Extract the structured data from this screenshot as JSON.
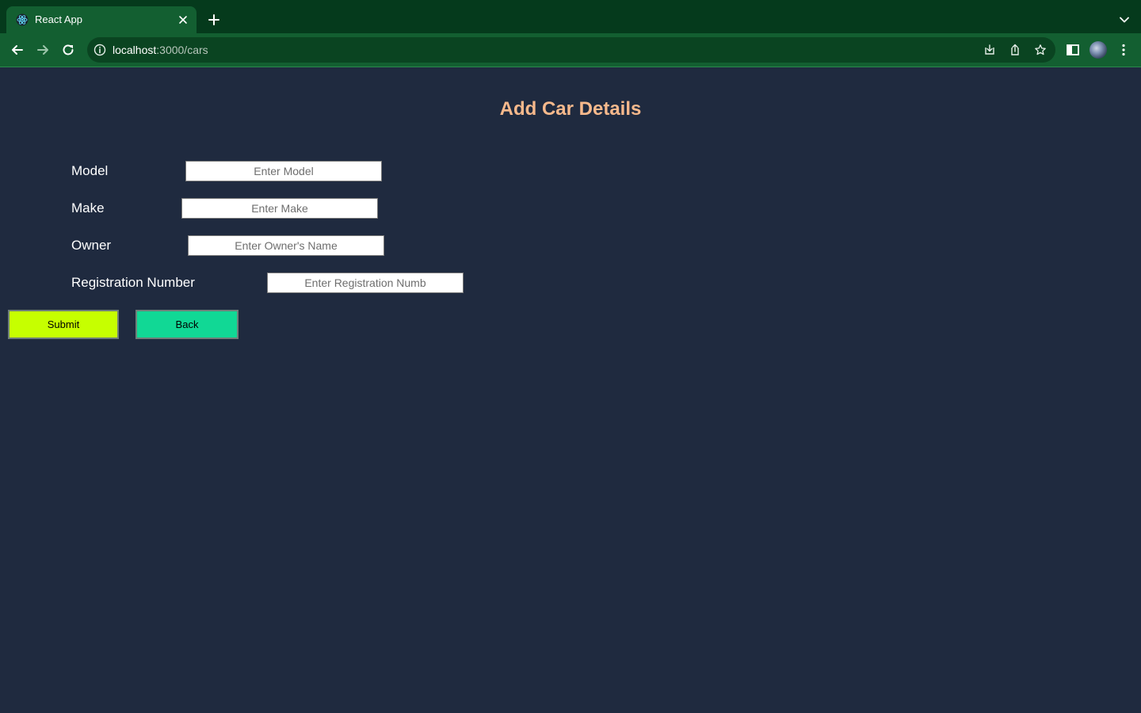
{
  "browser": {
    "tab_title": "React App",
    "url_host": "localhost",
    "url_rest": ":3000/cars",
    "icons": {
      "favicon": "react-logo-icon",
      "close": "close-icon",
      "new_tab": "plus-icon",
      "tab_list": "chevron-down-icon",
      "back": "arrow-left-icon",
      "forward": "arrow-right-icon",
      "reload": "reload-icon",
      "site_info": "info-icon",
      "install": "install-icon",
      "share": "share-icon",
      "bookmark": "star-icon",
      "side_panel": "side-panel-icon",
      "profile": "avatar",
      "menu": "kebab-menu-icon"
    },
    "colors": {
      "tabbar": "#053a1c",
      "toolbar": "#135f31"
    }
  },
  "page": {
    "title": "Add Car Details",
    "fields": [
      {
        "label": "Model",
        "placeholder": "Enter Model",
        "value": ""
      },
      {
        "label": "Make",
        "placeholder": "Enter Make",
        "value": ""
      },
      {
        "label": "Owner",
        "placeholder": "Enter Owner's Name",
        "value": ""
      },
      {
        "label": "Registration Number",
        "placeholder": "Enter Registration Numb",
        "value": ""
      }
    ],
    "buttons": {
      "submit": "Submit",
      "back": "Back"
    },
    "colors": {
      "background": "#1f2a3f",
      "title": "#f7b98c",
      "submit": "#c6ff00",
      "back": "#11d895"
    }
  }
}
